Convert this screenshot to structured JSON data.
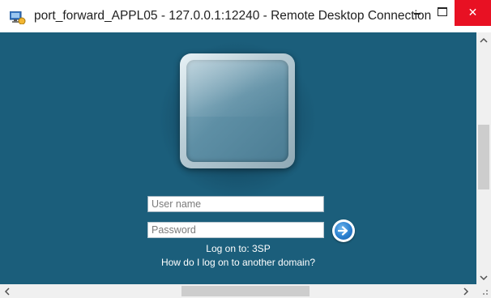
{
  "window": {
    "title": "port_forward_APPL05 - 127.0.0.1:12240 - Remote Desktop Connection",
    "icon": "remote-desktop-icon",
    "controls": [
      "minimize",
      "maximize",
      "close"
    ],
    "close_color": "#e81123"
  },
  "logon": {
    "background_color": "#1b5e7b",
    "user_avatar_icon": "user-tile-icon",
    "username_placeholder": "User name",
    "username_value": "",
    "password_placeholder": "Password",
    "password_value": "",
    "submit_icon": "arrow-right-icon",
    "logon_to": "Log on to: 3SP",
    "help_link": "How do I log on to another domain?"
  },
  "scrollbars": {
    "vertical": {
      "up_icon": "chevron-up-icon",
      "down_icon": "chevron-down-icon"
    },
    "horizontal": {
      "left_icon": "chevron-left-icon",
      "right_icon": "chevron-right-icon"
    }
  }
}
